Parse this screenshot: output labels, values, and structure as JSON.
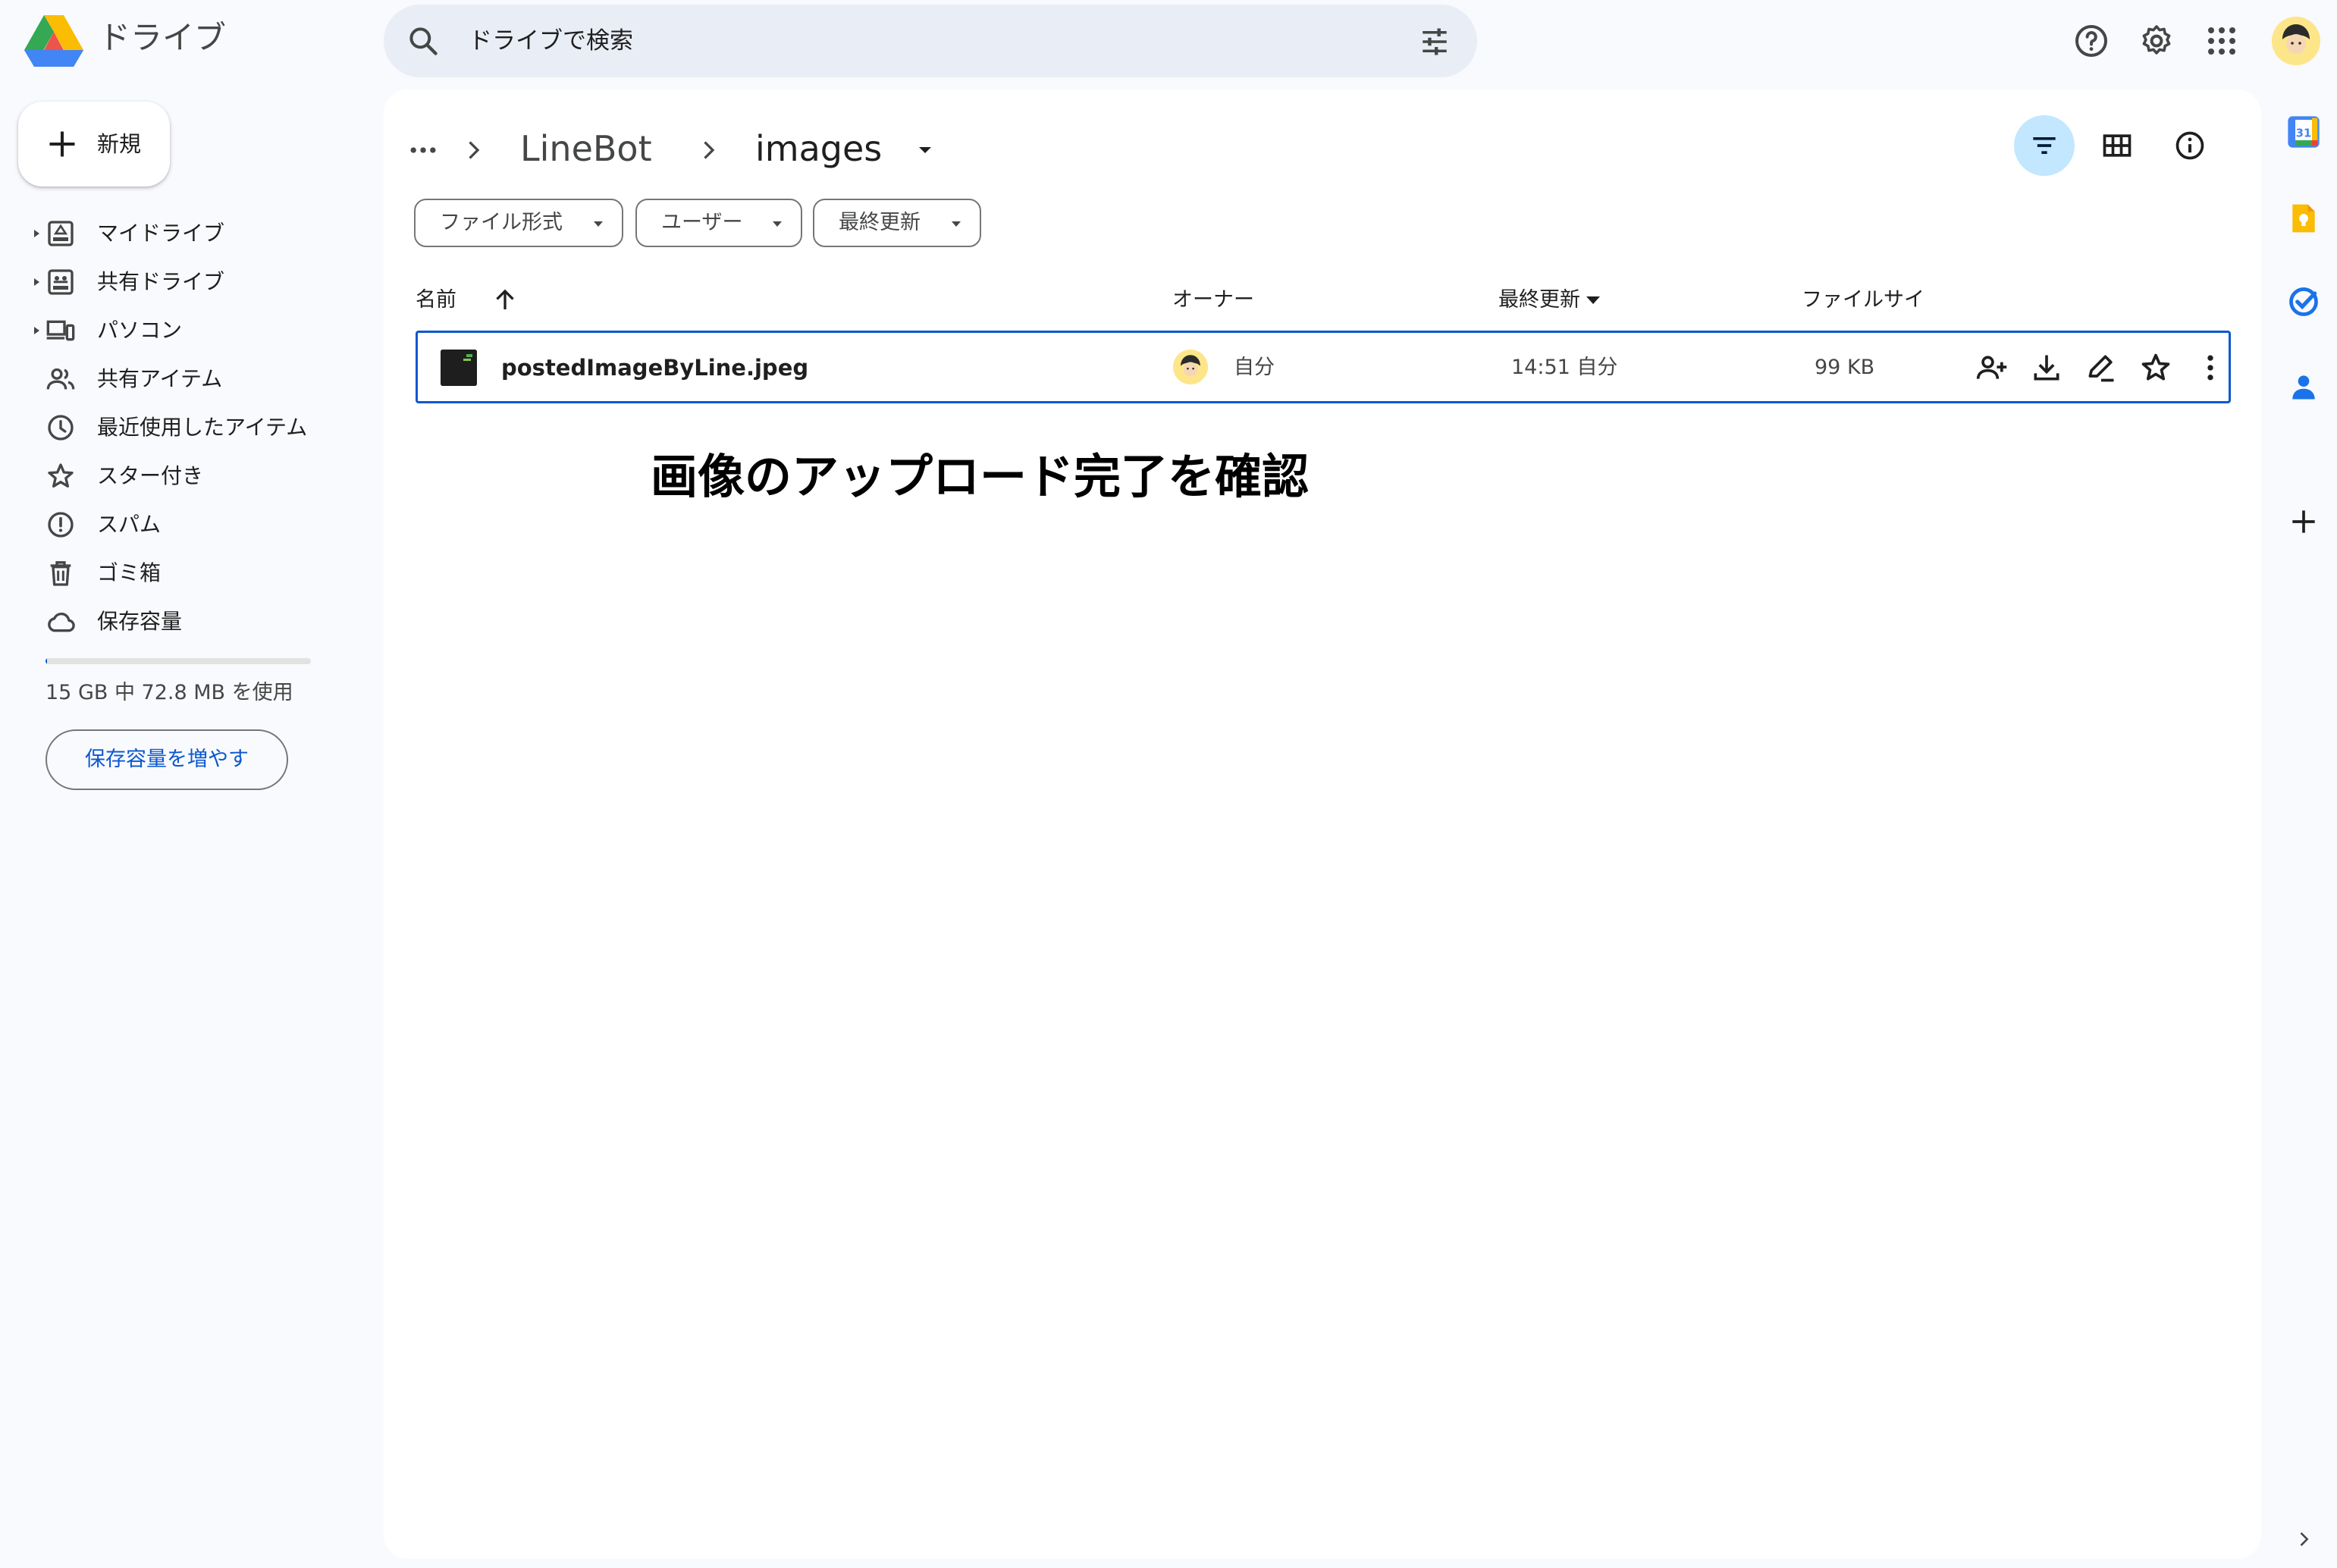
{
  "app": {
    "title": "ドライブ"
  },
  "search": {
    "placeholder": "ドライブで検索"
  },
  "header_icons": [
    "help-icon",
    "settings-icon",
    "apps-grid-icon",
    "account-avatar"
  ],
  "sidebar": {
    "new_label": "新規",
    "items": [
      {
        "label": "マイドライブ",
        "icon": "my-drive-icon",
        "expandable": true
      },
      {
        "label": "共有ドライブ",
        "icon": "shared-drive-icon",
        "expandable": true
      },
      {
        "label": "パソコン",
        "icon": "computers-icon",
        "expandable": true
      },
      {
        "label": "共有アイテム",
        "icon": "shared-people-icon",
        "expandable": false
      },
      {
        "label": "最近使用したアイテム",
        "icon": "clock-icon",
        "expandable": false
      },
      {
        "label": "スター付き",
        "icon": "star-icon",
        "expandable": false
      },
      {
        "label": "スパム",
        "icon": "spam-icon",
        "expandable": false
      },
      {
        "label": "ゴミ箱",
        "icon": "trash-icon",
        "expandable": false
      },
      {
        "label": "保存容量",
        "icon": "cloud-icon",
        "expandable": false
      }
    ],
    "storage": {
      "used_text": "15 GB 中 72.8 MB を使用",
      "used_fraction": 0.005
    },
    "more_storage_label": "保存容量を増やす"
  },
  "breadcrumb": {
    "items": [
      "LineBot",
      "images"
    ]
  },
  "filters": [
    "ファイル形式",
    "ユーザー",
    "最終更新"
  ],
  "columns": {
    "name": "名前",
    "owner": "オーナー",
    "modified": "最終更新",
    "size": "ファイルサイ"
  },
  "files": [
    {
      "name": "postedImageByLine.jpeg",
      "owner": "自分",
      "modified": "14:51 自分",
      "size": "99 KB"
    }
  ],
  "annotation": "画像のアップロード完了を確認",
  "colors": {
    "accent": "#0b57d0",
    "selected_view": "#c2e7ff",
    "search_bg": "#e9eef6",
    "page_bg": "#f8fafd"
  }
}
